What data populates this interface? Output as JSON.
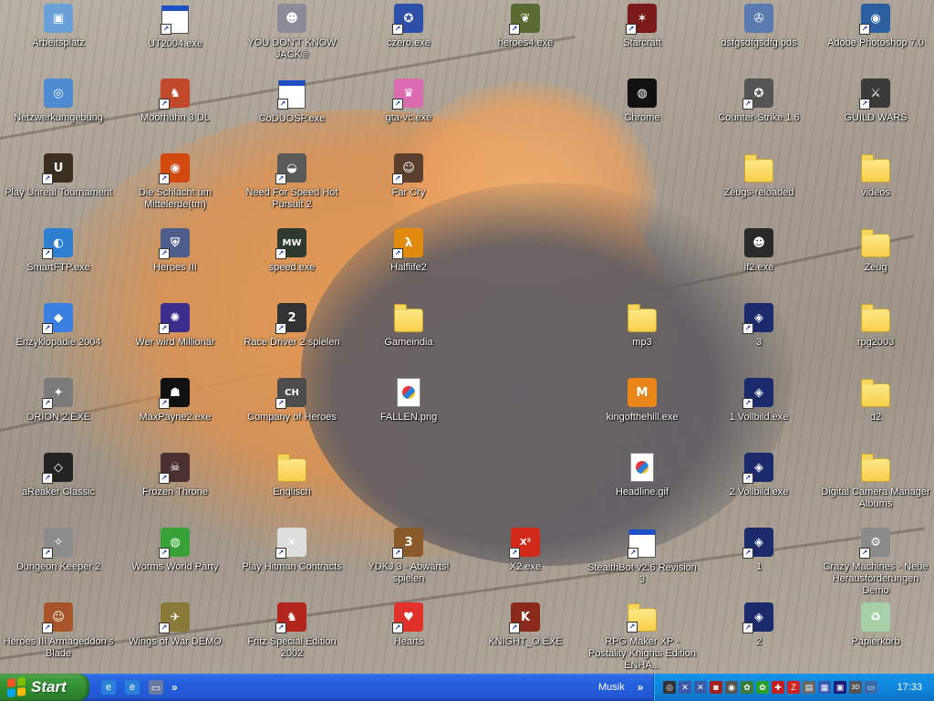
{
  "desktop": {
    "icons": [
      {
        "label": "Arbeitsplatz",
        "icon": "computer-icon",
        "kind": "app",
        "color": "#6aa0d8",
        "glyph": "▣",
        "shortcut": false
      },
      {
        "label": "Netzwerkumgebung",
        "icon": "network-icon",
        "kind": "app",
        "color": "#4e8bd0",
        "glyph": "◎",
        "shortcut": false
      },
      {
        "label": "Play Unreal Tournament",
        "icon": "unreal-tournament-icon",
        "kind": "app",
        "color": "#3b2f22",
        "glyph": "U",
        "shortcut": true
      },
      {
        "label": "SmartFTP.exe",
        "icon": "smartftp-icon",
        "kind": "app",
        "color": "#2f7fd0",
        "glyph": "◐",
        "shortcut": true
      },
      {
        "label": "Enzyklopädie 2004",
        "icon": "encyclopedia-icon",
        "kind": "app",
        "color": "#3b7fe0",
        "glyph": "◆",
        "shortcut": true
      },
      {
        "label": "ORION 2.EXE",
        "icon": "satellite-icon",
        "kind": "app",
        "color": "#7a7a7a",
        "glyph": "✦",
        "shortcut": true
      },
      {
        "label": "aReaker Classic",
        "icon": "areaker-icon",
        "kind": "app",
        "color": "#222222",
        "glyph": "◇",
        "shortcut": true
      },
      {
        "label": "Dungeon Keeper 2",
        "icon": "dungeon-keeper-icon",
        "kind": "app",
        "color": "#8c8c8c",
        "glyph": "✧",
        "shortcut": true
      },
      {
        "label": "Heroes III Armageddon's Blade",
        "icon": "heroes-armageddon-icon",
        "kind": "app",
        "color": "#a8542a",
        "glyph": "☺",
        "shortcut": true
      },
      {
        "label": "UT2004.exe",
        "icon": "ut2004-icon",
        "kind": "window",
        "color": "#1f4fc7",
        "glyph": "",
        "shortcut": true
      },
      {
        "label": "Moorhuhn 3 DL",
        "icon": "moorhuhn-icon",
        "kind": "app",
        "color": "#c0492b",
        "glyph": "♞",
        "shortcut": true
      },
      {
        "label": "Die Schlacht um Mittelerde(tm)",
        "icon": "eye-of-sauron-icon",
        "kind": "app",
        "color": "#d14a10",
        "glyph": "◉",
        "shortcut": true
      },
      {
        "label": "Heroes III",
        "icon": "heroes3-shield-icon",
        "kind": "app",
        "color": "#4d5e8a",
        "glyph": "⛨",
        "shortcut": true
      },
      {
        "label": "Wer wird Millionär",
        "icon": "millionaire-icon",
        "kind": "app",
        "color": "#3a2d8c",
        "glyph": "✺",
        "shortcut": true
      },
      {
        "label": "MaxPayne2.exe",
        "icon": "maxpayne-icon",
        "kind": "app",
        "color": "#111111",
        "glyph": "☗",
        "shortcut": true
      },
      {
        "label": "Frozen Throne",
        "icon": "frozen-throne-icon",
        "kind": "app",
        "color": "#4a3030",
        "glyph": "☠",
        "shortcut": true
      },
      {
        "label": "Worms World Party",
        "icon": "worms-icon",
        "kind": "app",
        "color": "#3aa13a",
        "glyph": "◍",
        "shortcut": true
      },
      {
        "label": "Wings of War DEMO",
        "icon": "wings-of-war-icon",
        "kind": "app",
        "color": "#8a7a3a",
        "glyph": "✈",
        "shortcut": true
      },
      {
        "label": "YOU DON'T KNOW JACK®",
        "icon": "ydkj-icon",
        "kind": "app",
        "color": "#8b8b9a",
        "glyph": "☻",
        "shortcut": false
      },
      {
        "label": "CoDUOSP.exe",
        "icon": "coduosp-icon",
        "kind": "window",
        "color": "#1f4fc7",
        "glyph": "",
        "shortcut": true
      },
      {
        "label": "Need For Speed Hot Pursuit 2",
        "icon": "nfs-icon",
        "kind": "app",
        "color": "#5a5a5a",
        "glyph": "◒",
        "shortcut": true
      },
      {
        "label": "speed.exe",
        "icon": "nfs-mw-icon",
        "kind": "app",
        "color": "#2d3a2d",
        "glyph": "MW",
        "shortcut": true
      },
      {
        "label": "Race Driver 2 spielen",
        "icon": "race-driver-icon",
        "kind": "app",
        "color": "#333333",
        "glyph": "2",
        "shortcut": true
      },
      {
        "label": "Company of Heroes",
        "icon": "company-of-heroes-icon",
        "kind": "app",
        "color": "#4d4d4d",
        "glyph": "CH",
        "shortcut": true
      },
      {
        "label": "Englisch",
        "icon": "folder-icon",
        "kind": "folder",
        "color": "#f6cf4a",
        "glyph": "",
        "shortcut": false
      },
      {
        "label": "Play Hitman Contracts",
        "icon": "hitman-icon",
        "kind": "app",
        "color": "#dddddd",
        "glyph": "✕",
        "shortcut": true
      },
      {
        "label": "Fritz Special Edition 2002",
        "icon": "fritz-chess-icon",
        "kind": "app",
        "color": "#b3261e",
        "glyph": "♞",
        "shortcut": true
      },
      {
        "label": "czero.exe",
        "icon": "counter-strike-zero-icon",
        "kind": "app",
        "color": "#2e4fa8",
        "glyph": "✪",
        "shortcut": true
      },
      {
        "label": "gta-vc.exe",
        "icon": "gta-vice-city-icon",
        "kind": "app",
        "color": "#d96bb0",
        "glyph": "♛",
        "shortcut": true
      },
      {
        "label": "Far Cry",
        "icon": "far-cry-icon",
        "kind": "app",
        "color": "#5b4030",
        "glyph": "☺",
        "shortcut": true
      },
      {
        "label": "Halflife2",
        "icon": "half-life-icon",
        "kind": "app",
        "color": "#e08a10",
        "glyph": "λ",
        "shortcut": true
      },
      {
        "label": "Gameindia",
        "icon": "folder-icon",
        "kind": "folder",
        "color": "#f6cf4a",
        "glyph": "",
        "shortcut": false
      },
      {
        "label": "FALLEN.png",
        "icon": "image-file-icon",
        "kind": "doc",
        "color": "#ffffff",
        "glyph": "",
        "shortcut": false
      },
      {
        "label": "YDKJ 3 - Abwärts! spielen",
        "icon": "ydkj3-icon",
        "kind": "app",
        "color": "#8a5a2a",
        "glyph": "3",
        "shortcut": true
      },
      {
        "label": "Hearts",
        "icon": "heart-icon",
        "kind": "app",
        "color": "#e0322a",
        "glyph": "♥",
        "shortcut": true
      },
      {
        "label": "heroes4.exe",
        "icon": "heroes4-dragon-icon",
        "kind": "app",
        "color": "#5a6a30",
        "glyph": "❦",
        "shortcut": true
      },
      {
        "label": "X2.exe",
        "icon": "x2-icon",
        "kind": "app",
        "color": "#d12a1a",
        "glyph": "X²",
        "shortcut": true
      },
      {
        "label": "KNIGHT_O.EXE",
        "icon": "knight-icon",
        "kind": "app",
        "color": "#8a2a1a",
        "glyph": "K",
        "shortcut": true
      },
      {
        "label": "Starcraft",
        "icon": "starcraft-icon",
        "kind": "app",
        "color": "#7a1a1a",
        "glyph": "✶",
        "shortcut": true
      },
      {
        "label": "Chrome",
        "icon": "chrome-icon",
        "kind": "app",
        "color": "#111111",
        "glyph": "◍",
        "shortcut": false
      },
      {
        "label": "mp3",
        "icon": "folder-icon",
        "kind": "folder",
        "color": "#f6cf4a",
        "glyph": "",
        "shortcut": false
      },
      {
        "label": "kingofthehill.exe",
        "icon": "miniclip-icon",
        "kind": "app",
        "color": "#e8861a",
        "glyph": "M",
        "shortcut": false
      },
      {
        "label": "Headline.gif",
        "icon": "image-file-icon",
        "kind": "doc",
        "color": "#ffffff",
        "glyph": "",
        "shortcut": false
      },
      {
        "label": "StealthBot v2.6 Revision 3",
        "icon": "stealthbot-icon",
        "kind": "window",
        "color": "#1f4fc7",
        "glyph": "",
        "shortcut": true
      },
      {
        "label": "RPG Maker XP - Postality Knights Edition ENHA...",
        "icon": "folder-icon",
        "kind": "folder",
        "color": "#f6cf4a",
        "glyph": "",
        "shortcut": true
      },
      {
        "label": "dsfgsdfgsdfg.pds",
        "icon": "film-reel-icon",
        "kind": "app",
        "color": "#5a7ab0",
        "glyph": "✇",
        "shortcut": false
      },
      {
        "label": "Counter-Strike 1.6",
        "icon": "counter-strike-icon",
        "kind": "app",
        "color": "#555555",
        "glyph": "✪",
        "shortcut": true
      },
      {
        "label": "Zeugs-reloaded",
        "icon": "folder-icon",
        "kind": "folder",
        "color": "#f6cf4a",
        "glyph": "",
        "shortcut": false
      },
      {
        "label": "lf2.exe",
        "icon": "little-fighter-icon",
        "kind": "app",
        "color": "#2a2a2a",
        "glyph": "☻",
        "shortcut": false
      },
      {
        "label": "3",
        "icon": "warcraft-orb-icon",
        "kind": "app",
        "color": "#1b2a6a",
        "glyph": "◈",
        "shortcut": true
      },
      {
        "label": "1 Vollbild.exe",
        "icon": "warcraft-orb-icon",
        "kind": "app",
        "color": "#1b2a6a",
        "glyph": "◈",
        "shortcut": true
      },
      {
        "label": "2 Vollbild.exe",
        "icon": "warcraft-orb-icon",
        "kind": "app",
        "color": "#1b2a6a",
        "glyph": "◈",
        "shortcut": true
      },
      {
        "label": "1",
        "icon": "warcraft-orb-icon",
        "kind": "app",
        "color": "#1b2a6a",
        "glyph": "◈",
        "shortcut": true
      },
      {
        "label": "2",
        "icon": "warcraft-orb-icon",
        "kind": "app",
        "color": "#1b2a6a",
        "glyph": "◈",
        "shortcut": true
      },
      {
        "label": "Adobe Photoshop 7.0",
        "icon": "photoshop-icon",
        "kind": "app",
        "color": "#2b5f9e",
        "glyph": "◉",
        "shortcut": true
      },
      {
        "label": "GUILD WARS",
        "icon": "guild-wars-icon",
        "kind": "app",
        "color": "#3a3a3a",
        "glyph": "⚔",
        "shortcut": true
      },
      {
        "label": "videos",
        "icon": "folder-icon",
        "kind": "folder",
        "color": "#f6cf4a",
        "glyph": "",
        "shortcut": false
      },
      {
        "label": "Zeug",
        "icon": "folder-icon",
        "kind": "folder",
        "color": "#f6cf4a",
        "glyph": "",
        "shortcut": false
      },
      {
        "label": "rpg2003",
        "icon": "folder-icon",
        "kind": "folder",
        "color": "#f6cf4a",
        "glyph": "",
        "shortcut": false
      },
      {
        "label": "d2",
        "icon": "folder-icon",
        "kind": "folder",
        "color": "#f6cf4a",
        "glyph": "",
        "shortcut": false
      },
      {
        "label": "Digital Camera Manager Albums",
        "icon": "folder-icon",
        "kind": "folder",
        "color": "#f6cf4a",
        "glyph": "",
        "shortcut": false
      },
      {
        "label": "Crazy Machines - Neue Herausforderungen Demo",
        "icon": "crazy-machines-icon",
        "kind": "app",
        "color": "#8a8a8a",
        "glyph": "⚙",
        "shortcut": true
      },
      {
        "label": "Papierkorb",
        "icon": "recycle-bin-icon",
        "kind": "app",
        "color": "#a8d0a8",
        "glyph": "♻",
        "shortcut": false
      }
    ]
  },
  "taskbar": {
    "start_label": "Start",
    "start_logo_colors": [
      "#f35325",
      "#81bc06",
      "#05a6f0",
      "#ffba08"
    ],
    "quick_launch": [
      {
        "icon": "internet-explorer-icon",
        "color": "#2a7fd8",
        "glyph": "e"
      },
      {
        "icon": "ie-browser-icon",
        "color": "#2a7fd8",
        "glyph": "e"
      },
      {
        "icon": "show-desktop-icon",
        "color": "#6a7aa0",
        "glyph": "▭"
      }
    ],
    "more_glyph": "»",
    "toolbar_label": "Musik",
    "tray_icons": [
      {
        "icon": "headset-icon",
        "color": "#333333",
        "glyph": "◎"
      },
      {
        "icon": "network-disconnected-icon",
        "color": "#3a5aa8",
        "glyph": "✕"
      },
      {
        "icon": "network-disconnected-icon",
        "color": "#3a5aa8",
        "glyph": "✕"
      },
      {
        "icon": "cd-icon",
        "color": "#a02020",
        "glyph": "◙"
      },
      {
        "icon": "shield-icon",
        "color": "#555555",
        "glyph": "◉"
      },
      {
        "icon": "gear-icon",
        "color": "#3a7a3a",
        "glyph": "✿"
      },
      {
        "icon": "icq-flower-icon",
        "color": "#2aa02a",
        "glyph": "✿"
      },
      {
        "icon": "antivirus-icon",
        "color": "#c02020",
        "glyph": "✚"
      },
      {
        "icon": "zonealarm-icon",
        "color": "#d02020",
        "glyph": "Z"
      },
      {
        "icon": "keyboard-icon",
        "color": "#666666",
        "glyph": "▤"
      },
      {
        "icon": "checkered-icon",
        "color": "#3a5ab0",
        "glyph": "▦"
      },
      {
        "icon": "display-icon",
        "color": "#1a1a7a",
        "glyph": "▣"
      },
      {
        "icon": "3d-icon",
        "color": "#555555",
        "glyph": "3D"
      },
      {
        "icon": "monitor-icon",
        "color": "#3a6aa8",
        "glyph": "▭"
      }
    ],
    "clock": "17:33"
  }
}
